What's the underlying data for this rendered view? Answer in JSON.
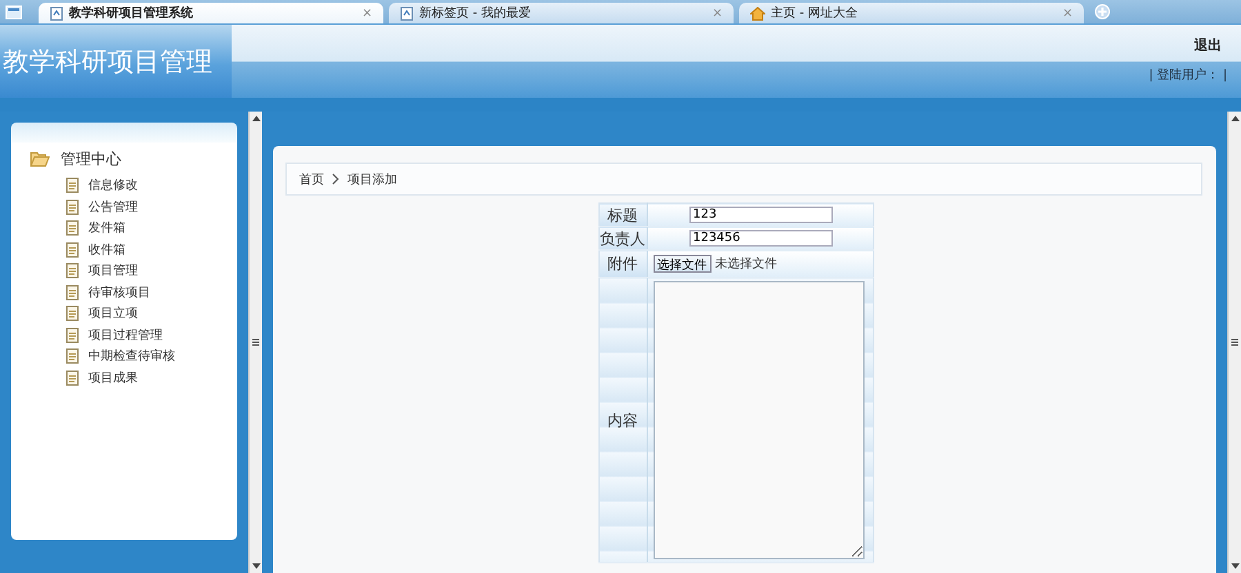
{
  "browser_tabs": [
    {
      "title": "教学科研项目管理系统",
      "close": "×",
      "selected": true
    },
    {
      "title": "新标签页 - 我的最爱",
      "close": "×",
      "selected": false
    },
    {
      "title": "主页 - 网址大全",
      "close": "×",
      "selected": false
    }
  ],
  "header": {
    "title": "教学科研项目管理",
    "logout": "退出",
    "user_label": "| 登陆用户：  |"
  },
  "sidebar": {
    "root": {
      "label": "管理中心",
      "expanded": true,
      "children": [
        {
          "label": "信息修改"
        },
        {
          "label": "公告管理"
        },
        {
          "label": "发件箱"
        },
        {
          "label": "收件箱"
        },
        {
          "label": "项目管理"
        },
        {
          "label": "待审核项目"
        },
        {
          "label": "项目立项"
        },
        {
          "label": "项目过程管理"
        },
        {
          "label": "中期检查待审核"
        },
        {
          "label": "项目成果"
        }
      ]
    }
  },
  "breadcrumb": [
    "首页",
    "项目添加"
  ],
  "form": {
    "fields": [
      {
        "kind": "text",
        "label": "标题",
        "value": "123"
      },
      {
        "kind": "text",
        "label": "负责人",
        "value": "123456"
      },
      {
        "kind": "file",
        "label": "附件",
        "button": "选择文件",
        "status": "未选择文件"
      },
      {
        "kind": "textarea",
        "label": "内容"
      }
    ]
  }
}
